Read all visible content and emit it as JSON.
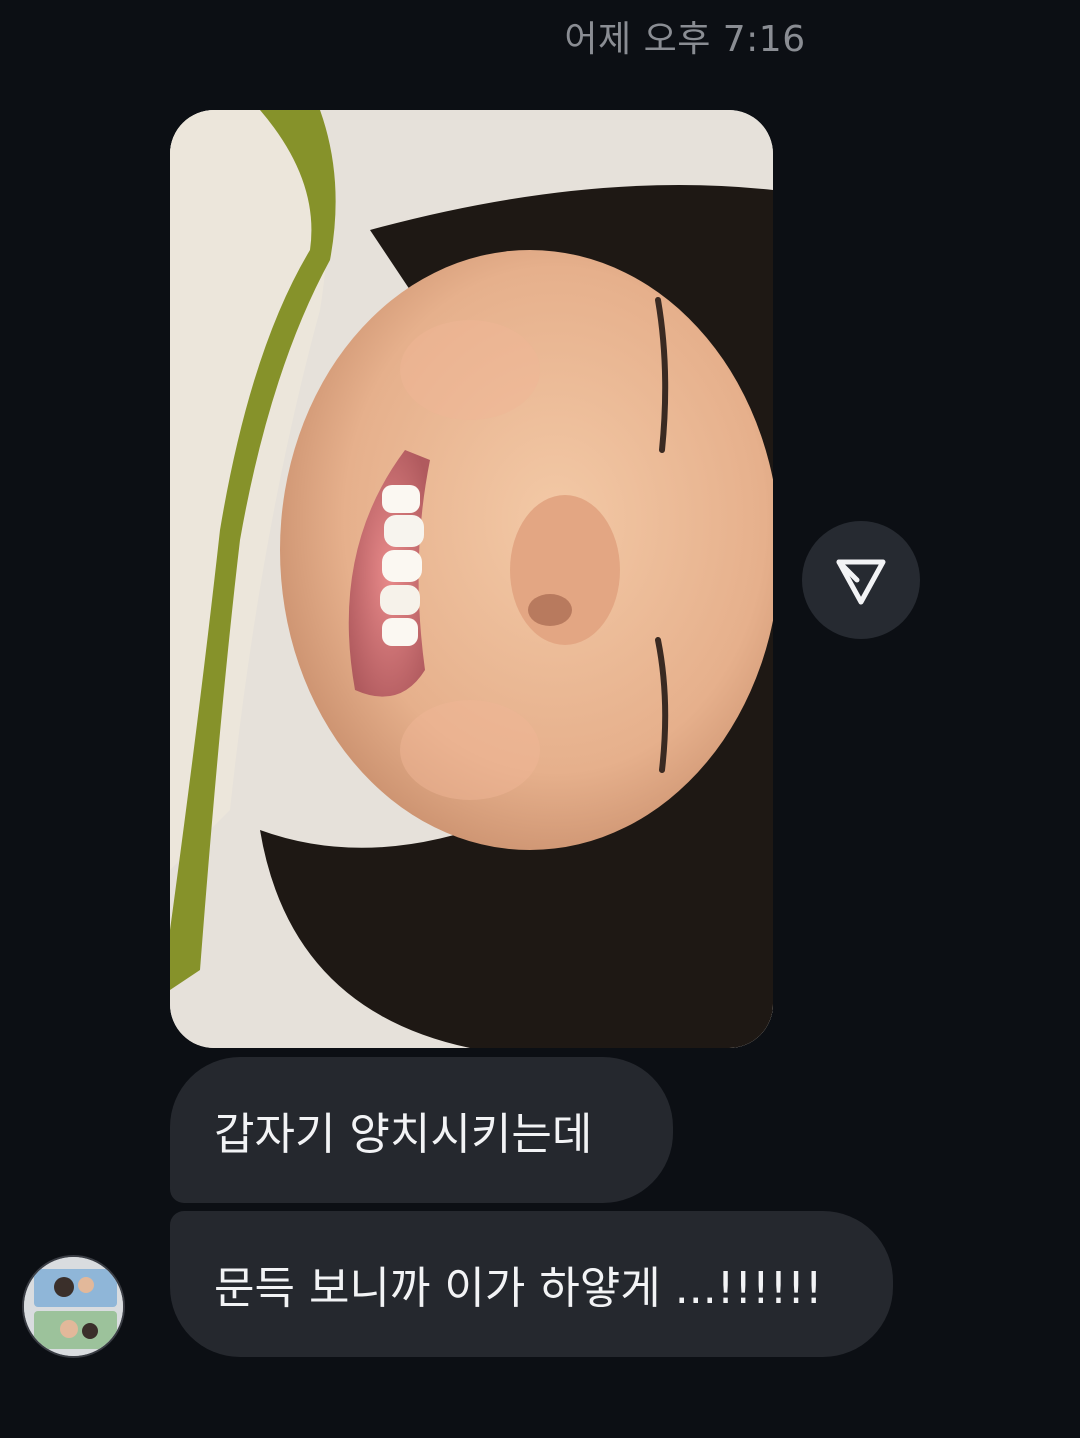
{
  "thread": {
    "timestamp": "어제 오후 7:16"
  },
  "messages": [
    {
      "type": "photo",
      "description_icon": "photo-thumbnail"
    },
    {
      "type": "text",
      "text": "갑자기 양치시키는데"
    },
    {
      "type": "text",
      "text": "문득 보니까 이가 하얗게 ...!!!!!!"
    }
  ],
  "actions": {
    "share_icon": "send-triangle-icon"
  },
  "colors": {
    "background": "#0c0f14",
    "bubble": "#25282e",
    "text": "#f2f3f5",
    "timestamp": "#8a8d93",
    "share_button": "#262a31"
  }
}
